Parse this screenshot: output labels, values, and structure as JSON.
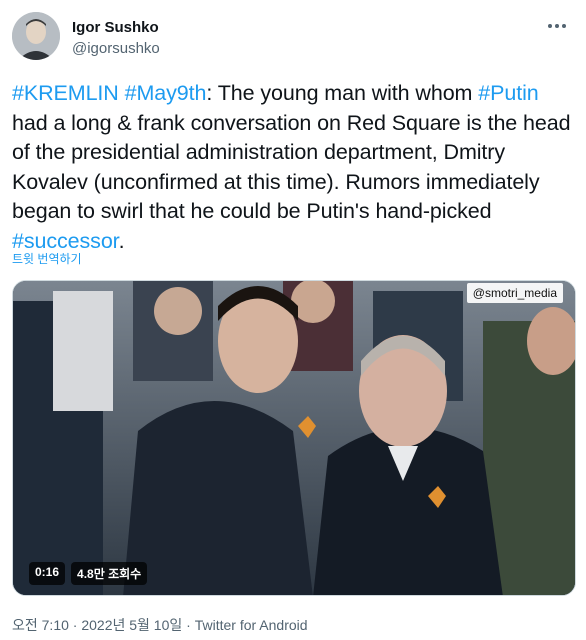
{
  "author": {
    "display_name": "Igor Sushko",
    "handle": "@igorsushko"
  },
  "tweet": {
    "segments": [
      {
        "text": "#KREMLIN",
        "type": "hashtag"
      },
      {
        "text": " ",
        "type": "text"
      },
      {
        "text": "#May9th",
        "type": "hashtag"
      },
      {
        "text": ": The young man with whom ",
        "type": "text"
      },
      {
        "text": "#Putin",
        "type": "hashtag"
      },
      {
        "text": " had a long & frank conversation on Red Square is the head of the presidential administration department, Dmitry Kovalev (unconfirmed at this time). Rumors immediately began to swirl that he could be Putin's hand-picked ",
        "type": "text"
      },
      {
        "text": "#successor",
        "type": "hashtag"
      },
      {
        "text": ".",
        "type": "text"
      }
    ],
    "translate_label": "트윗 번역하기"
  },
  "media": {
    "watermark": "@smotri_media",
    "duration": "0:16",
    "views": "4.8만 조회수"
  },
  "meta": {
    "timestamp": "오전 7:10 · 2022년 5월 10일",
    "separator": " · ",
    "source": "Twitter for Android"
  },
  "icons": {
    "more": "more-dots-icon",
    "avatar": "avatar-photo"
  },
  "colors": {
    "link": "#1d9bf0",
    "secondary_text": "#536471",
    "primary_text": "#0f1419"
  }
}
